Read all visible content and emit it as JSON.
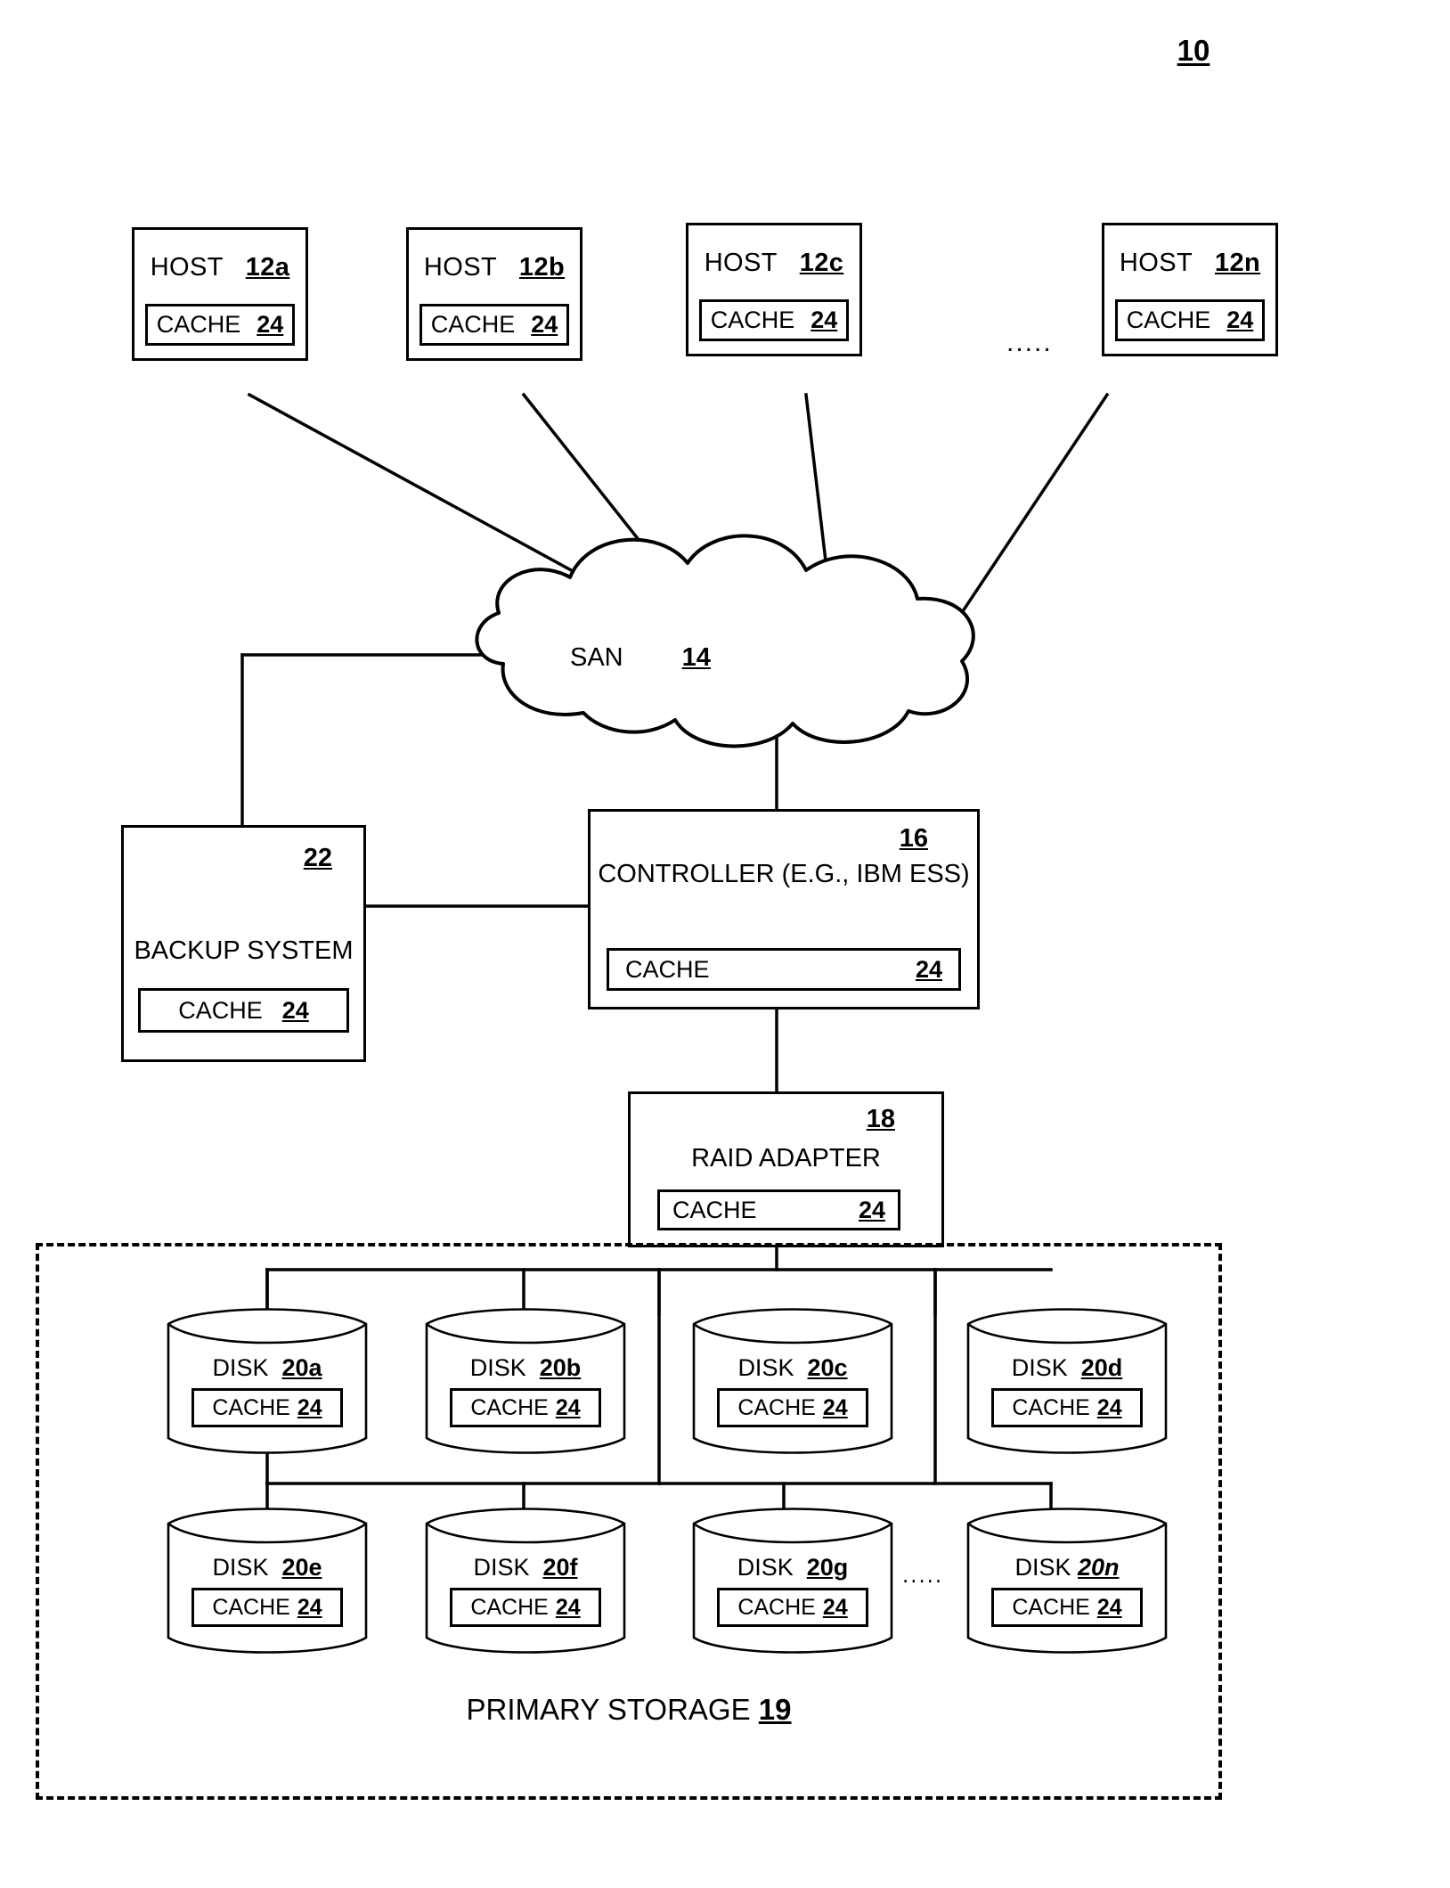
{
  "figure": {
    "number": "10",
    "type": "storage system block diagram"
  },
  "hosts": {
    "label": "HOST",
    "cache_label": "CACHE",
    "cache_ref": "24",
    "ellipsis": ".....",
    "items": [
      {
        "ref": "12a"
      },
      {
        "ref": "12b"
      },
      {
        "ref": "12c"
      },
      {
        "ref": "12n"
      }
    ]
  },
  "san": {
    "label": "SAN",
    "ref": "14"
  },
  "controller": {
    "title": "CONTROLLER (E.G., IBM ESS)",
    "ref": "16",
    "cache_label": "CACHE",
    "cache_ref": "24"
  },
  "backup": {
    "title": "BACKUP SYSTEM",
    "ref": "22",
    "cache_label": "CACHE",
    "cache_ref": "24"
  },
  "raid": {
    "title": "RAID ADAPTER",
    "ref": "18",
    "cache_label": "CACHE",
    "cache_ref": "24"
  },
  "primary_storage": {
    "label": "PRIMARY STORAGE",
    "ref": "19",
    "disk_label": "DISK",
    "cache_label": "CACHE",
    "cache_ref": "24",
    "ellipsis": ".....",
    "disks_row1": [
      {
        "ref": "20a"
      },
      {
        "ref": "20b"
      },
      {
        "ref": "20c"
      },
      {
        "ref": "20d"
      }
    ],
    "disks_row2": [
      {
        "ref": "20e"
      },
      {
        "ref": "20f"
      },
      {
        "ref": "20g"
      },
      {
        "ref": "20n"
      }
    ]
  },
  "colors": {
    "stroke": "#000000",
    "background": "#ffffff"
  }
}
